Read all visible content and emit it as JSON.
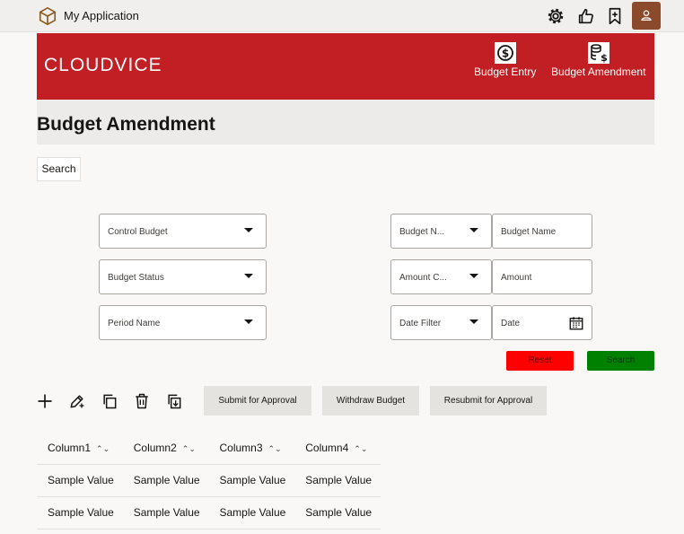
{
  "app": {
    "title": "My Application"
  },
  "banner": {
    "brand": "CLOUDVICE",
    "nav": [
      "Budget Entry",
      "Budget Amendment"
    ]
  },
  "page": {
    "title": "Budget Amendment",
    "search_tab": "Search"
  },
  "filters": {
    "control_budget": "Control Budget",
    "budget_status": "Budget Status",
    "period_name": "Period Name",
    "budget_num": "Budget N...",
    "budget_name": "Budget Name",
    "amount_cond": "Amount C...",
    "amount": "Amount",
    "date_filter": "Date Filter",
    "date": "Date"
  },
  "buttons": {
    "reset": "Reset",
    "search": "Search",
    "reset_color": "#ff0000",
    "search_color": "#008000"
  },
  "toolbar": {
    "submit": "Submit for Approval",
    "withdraw": "Withdraw Budget",
    "resubmit": "Resubmit for Approval"
  },
  "table": {
    "columns": [
      "Column1",
      "Column2",
      "Column3",
      "Column4"
    ],
    "rows": [
      [
        "Sample Value",
        "Sample Value",
        "Sample Value",
        "Sample Value"
      ],
      [
        "Sample Value",
        "Sample Value",
        "Sample Value",
        "Sample Value"
      ]
    ]
  }
}
